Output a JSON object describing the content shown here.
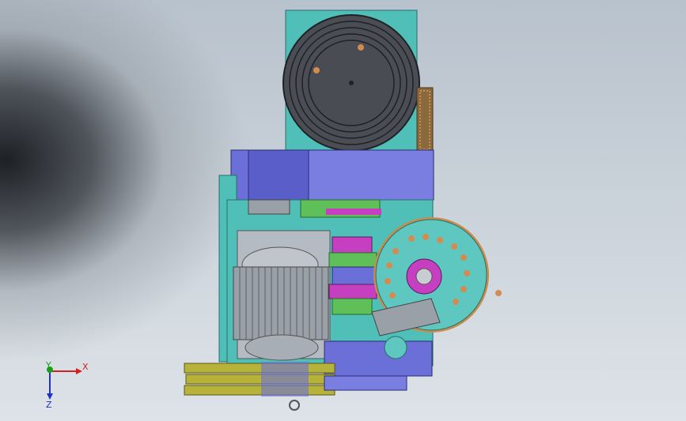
{
  "triad": {
    "x_label": "X",
    "y_label": "Y",
    "z_label": "Z",
    "x_color": "#d42020",
    "y_color": "#19a019",
    "z_color": "#2030c8"
  },
  "colors": {
    "background_top": "#b8c2cc",
    "background_bottom": "#dde3e8",
    "teal_frame": "#4fbfb8",
    "blue_guard": "#6b6fd8",
    "magenta_hub": "#c63fc0",
    "motor_grey": "#9aa0a8",
    "pulley_olive": "#b7b33a",
    "green_parts": "#5fc05a",
    "copper_chain": "#c88c4c"
  },
  "icons": {
    "triad": "axis-triad-icon"
  }
}
